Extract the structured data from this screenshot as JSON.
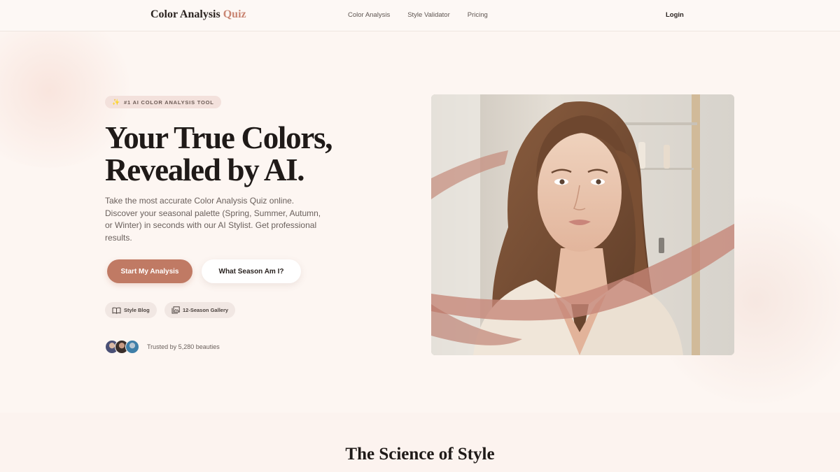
{
  "header": {
    "brand_primary": "Color Analysis",
    "brand_accent": "Quiz",
    "nav": [
      "Color Analysis",
      "Style Validator",
      "Pricing"
    ],
    "login": "Login"
  },
  "hero": {
    "tag": "#1 AI COLOR ANALYSIS TOOL",
    "title_line1": "Your True Colors,",
    "title_line2": "Revealed by AI.",
    "description": "Take the most accurate Color Analysis Quiz online. Discover your seasonal palette (Spring, Summer, Autumn, or Winter) in seconds with our AI Stylist. Get professional results.",
    "primary_cta": "Start My Analysis",
    "secondary_cta": "What Season Am I?",
    "chips": [
      {
        "label": "Style Blog",
        "icon": "book-icon"
      },
      {
        "label": "12-Season Gallery",
        "icon": "gallery-icon"
      }
    ],
    "trusted": "Trusted by 5,280 beauties"
  },
  "section": {
    "title": "The Science of Style"
  },
  "colors": {
    "accent": "#c07a64",
    "brand_accent": "#c98572",
    "background": "#fdf6f2",
    "text": "#1f1a18"
  }
}
